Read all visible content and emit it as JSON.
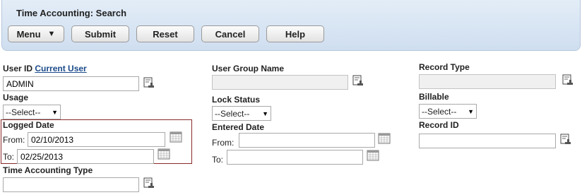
{
  "header": {
    "title": "Time Accounting: Search",
    "buttons": {
      "menu": "Menu",
      "submit": "Submit",
      "reset": "Reset",
      "cancel": "Cancel",
      "help": "Help"
    }
  },
  "form": {
    "user_id": {
      "label": "User ID",
      "link": "Current User",
      "value": "ADMIN"
    },
    "usage": {
      "label": "Usage",
      "selected": "--Select--"
    },
    "logged_date": {
      "label": "Logged Date",
      "from_label": "From:",
      "from_value": "02/10/2013",
      "to_label": "To:",
      "to_value": "02/25/2013"
    },
    "time_accounting_type": {
      "label": "Time Accounting Type",
      "value": ""
    },
    "user_group_name": {
      "label": "User Group Name",
      "value": ""
    },
    "lock_status": {
      "label": "Lock Status",
      "selected": "--Select--"
    },
    "entered_date": {
      "label": "Entered Date",
      "from_label": "From:",
      "from_value": "",
      "to_label": "To:",
      "to_value": ""
    },
    "record_type": {
      "label": "Record Type",
      "value": ""
    },
    "billable": {
      "label": "Billable",
      "selected": "--Select--"
    },
    "record_id": {
      "label": "Record ID",
      "value": ""
    }
  },
  "icons": {
    "lookup": "lookup-icon",
    "calendar": "calendar-icon"
  },
  "colors": {
    "header_bg": "#d9e6f3",
    "highlight_border": "#8b2a2a",
    "link": "#1a4a8a"
  }
}
